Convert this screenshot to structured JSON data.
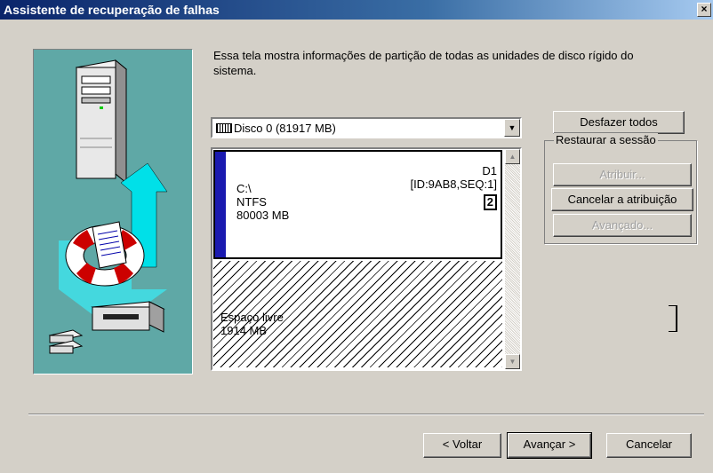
{
  "window": {
    "title": "Assistente de recuperação de falhas",
    "close": "×"
  },
  "description": "Essa tela mostra informações de partição de todas as unidades de disco rígido do sistema.",
  "disk_select": {
    "value": "Disco 0 (81917 MB)"
  },
  "partitions": [
    {
      "drive": "C:\\",
      "fs": "NTFS",
      "size": "80003 MB",
      "id_label": "D1",
      "id_detail": "[ID:9AB8,SEQ:1]",
      "index": "2"
    },
    {
      "label": "Espaço livre",
      "size": "1914 MB"
    }
  ],
  "buttons": {
    "undo_all": "Desfazer todos",
    "session_group": "Restaurar a sessão",
    "assign": "Atribuir...",
    "cancel_assign": "Cancelar a atribuição",
    "advanced": "Avançado...",
    "back": "< Voltar",
    "next": "Avançar >",
    "cancel": "Cancelar"
  }
}
